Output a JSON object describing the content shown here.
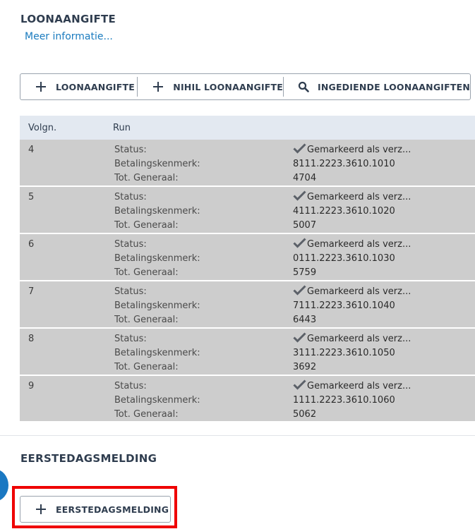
{
  "loonaangifte": {
    "title": "LOONAANGIFTE",
    "more_link": "Meer informatie...",
    "toolbar": {
      "add_label": "LOONAANGIFTE",
      "nihil_label": "NIHIL LOONAANGIFTE",
      "ingediend_label": "INGEDIENDE LOONAANGIFTEN"
    },
    "table": {
      "headers": {
        "volgn": "Volgn.",
        "run": "Run"
      },
      "field_labels": {
        "status": "Status:",
        "betaling": "Betalingskenmerk:",
        "totaal": "Tot. Generaal:"
      },
      "rows": [
        {
          "volgn": "4",
          "status": "Gemarkeerd als verz...",
          "betaling": "8111.2223.3610.1010",
          "totaal": "4704"
        },
        {
          "volgn": "5",
          "status": "Gemarkeerd als verz...",
          "betaling": "4111.2223.3610.1020",
          "totaal": "5007"
        },
        {
          "volgn": "6",
          "status": "Gemarkeerd als verz...",
          "betaling": "0111.2223.3610.1030",
          "totaal": "5759"
        },
        {
          "volgn": "7",
          "status": "Gemarkeerd als verz...",
          "betaling": "7111.2223.3610.1040",
          "totaal": "6443"
        },
        {
          "volgn": "8",
          "status": "Gemarkeerd als verz...",
          "betaling": "3111.2223.3610.1050",
          "totaal": "3692"
        },
        {
          "volgn": "9",
          "status": "Gemarkeerd als verz...",
          "betaling": "1111.2223.3610.1060",
          "totaal": "5062"
        }
      ]
    }
  },
  "eerstedagsmelding": {
    "title": "EERSTEDAGSMELDING",
    "add_label": "EERSTEDAGSMELDING"
  },
  "colors": {
    "link": "#1a7bbf",
    "header_bg": "#e3e9f1",
    "row_bg": "#cdcdcd",
    "highlight": "#ef0000",
    "accent_dot": "#1a78c2"
  },
  "icons": {
    "add": "plus-icon",
    "search": "search-icon",
    "status": "check-icon"
  }
}
